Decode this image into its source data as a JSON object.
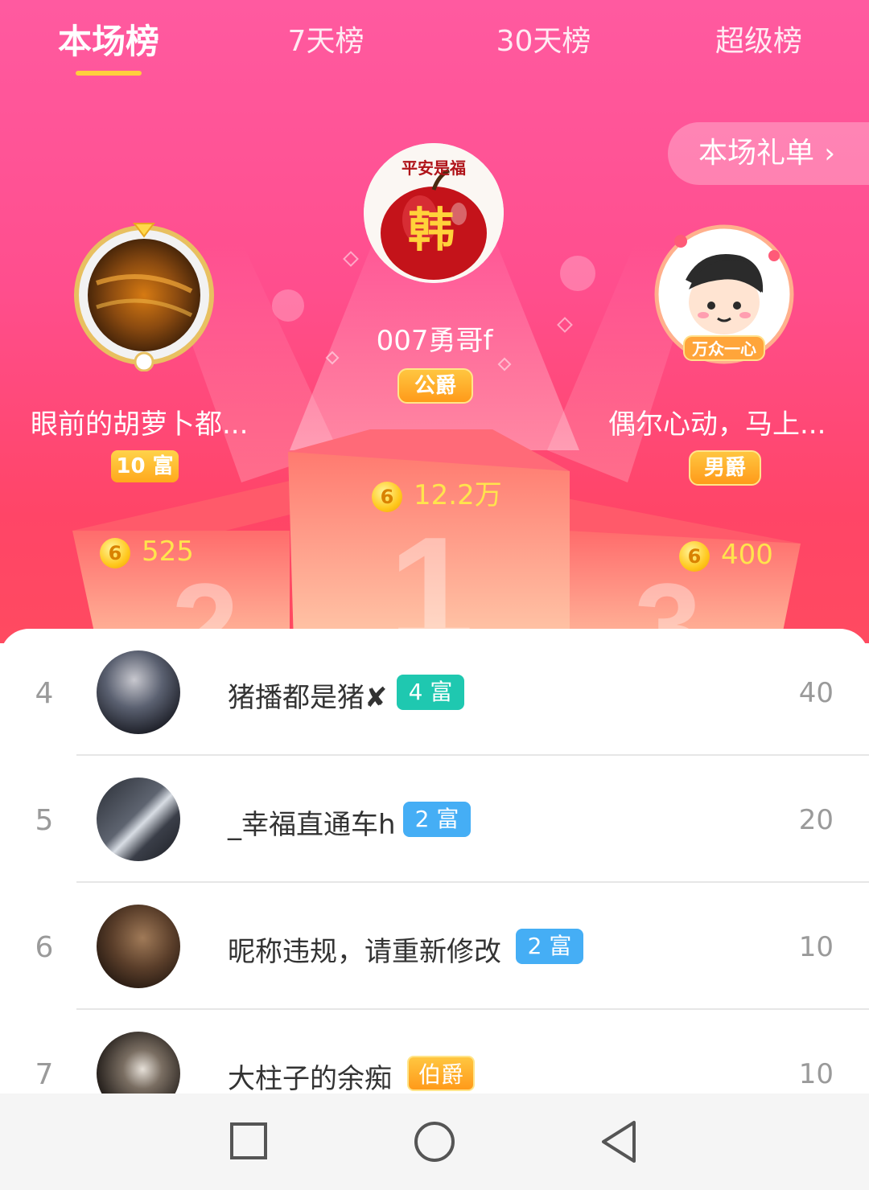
{
  "tabs": [
    "本场榜",
    "7天榜",
    "30天榜",
    "超级榜"
  ],
  "gift_list_label": "本场礼单",
  "podium": [
    {
      "rank": 1,
      "name": "007勇哥f",
      "badge": "公爵",
      "score": "12.2万"
    },
    {
      "rank": 2,
      "name": "眼前的胡萝卜都...",
      "badge": "10 富",
      "score": "525"
    },
    {
      "rank": 3,
      "name": "偶尔心动，马上...",
      "badge": "男爵",
      "score": "400"
    }
  ],
  "list": [
    {
      "rank": "4",
      "name": "猪播都是猪✘",
      "badge": "4 富",
      "badge_color": "#1fc8b0",
      "score": "40"
    },
    {
      "rank": "5",
      "name": "_幸福直通车h",
      "badge": "2 富",
      "badge_color": "#45aef5",
      "score": "20"
    },
    {
      "rank": "6",
      "name": "昵称违规，请重新修改",
      "badge": "2 富",
      "badge_color": "#45aef5",
      "score": "10"
    },
    {
      "rank": "7",
      "name": "大柱子的余痴",
      "badge": "伯爵",
      "badge_color": "#ffa41c",
      "score": "10"
    }
  ],
  "avatar_texts": {
    "first_place_top": "平安是福",
    "first_place_center": "韩",
    "third_place_banner": "万众一心"
  },
  "coin_glyph": "6",
  "icons": {
    "chevron": "chevron-right-icon",
    "nav": [
      "recent-apps-icon",
      "home-icon",
      "back-icon"
    ]
  },
  "colors": {
    "accent": "#ffcf3d",
    "score": "#ffe44d",
    "hero_top": "#ff5aa0",
    "hero_bottom": "#ff4567"
  }
}
